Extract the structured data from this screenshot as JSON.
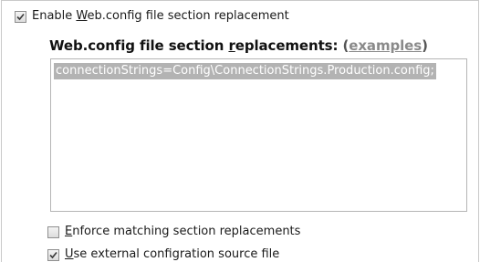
{
  "enable_replacement": {
    "checked": true,
    "label_before": "Enable ",
    "label_mnemonic": "W",
    "label_after": "eb.config file section replacement"
  },
  "replacements_group": {
    "title_before": "Web.config file section ",
    "title_mnemonic": "r",
    "title_after": "eplacements: ",
    "paren_open": "(",
    "examples_link": "examples",
    "paren_close": ")",
    "value": "connectionStrings=Config\\ConnectionStrings.Production.config;"
  },
  "enforce_matching": {
    "checked": false,
    "label_mnemonic": "E",
    "label_after": "nforce matching section replacements"
  },
  "use_external": {
    "checked": true,
    "label_mnemonic": "U",
    "label_after": "se external configration source file"
  },
  "colors": {
    "selection_bg": "#b3b3b3",
    "link": "#8a8a8a"
  }
}
